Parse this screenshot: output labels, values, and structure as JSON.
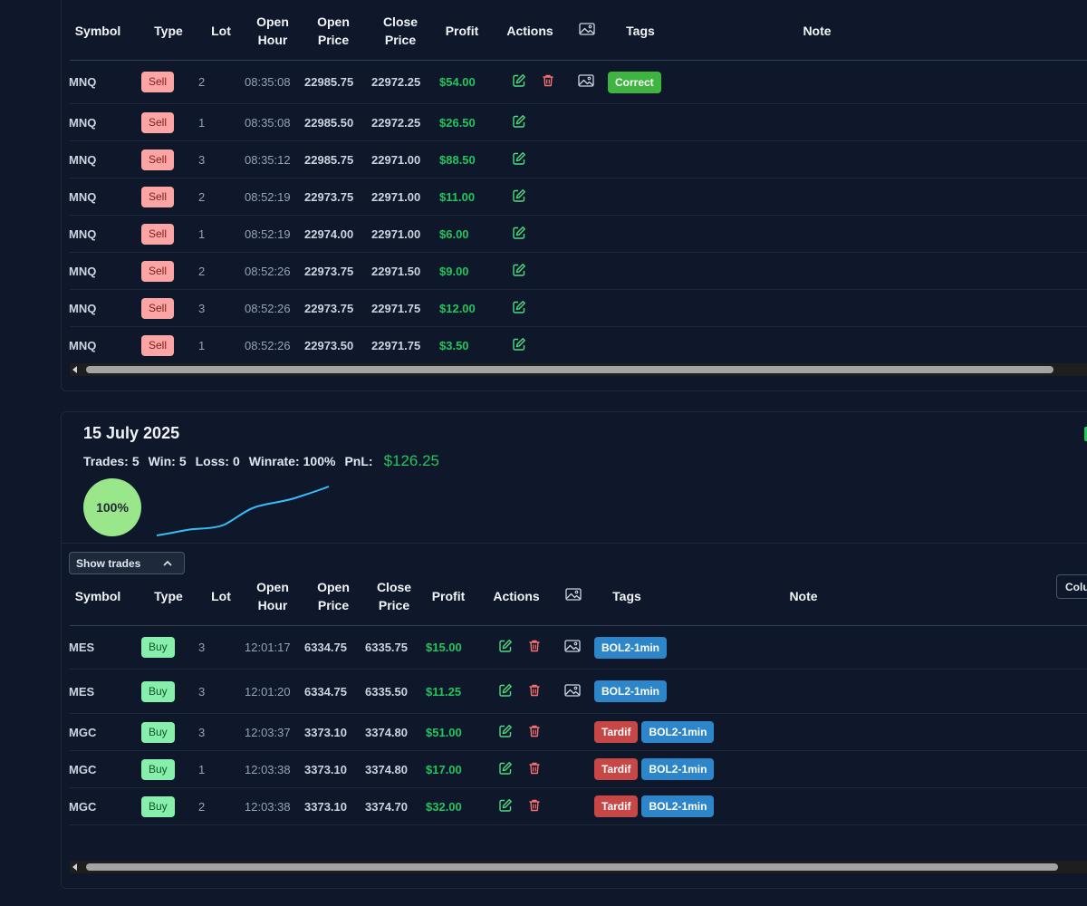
{
  "colors": {
    "background": "#0f172a",
    "profit": "#22c55e",
    "sell_badge": "#fca5a5",
    "buy_badge": "#86efac",
    "tag_correct": "#3fb541",
    "tag_bol2": "#2d86c9",
    "tag_tardif": "#c74747",
    "winrate_circle": "#9ae68a",
    "sparkline": "#38bdf8"
  },
  "table1": {
    "headers": {
      "symbol": "Symbol",
      "type": "Type",
      "lot": "Lot",
      "open_hour_1": "Open",
      "open_hour_2": "Hour",
      "open_price_1": "Open",
      "open_price_2": "Price",
      "close_price_1": "Close",
      "close_price_2": "Price",
      "profit": "Profit",
      "actions": "Actions",
      "image_icon": "image-icon",
      "tags": "Tags",
      "note": "Note"
    },
    "rows": [
      {
        "symbol": "MNQ",
        "type": "Sell",
        "lot": "2",
        "open_hour": "08:35:08",
        "open_price": "22985.75",
        "close_price": "22972.25",
        "profit": "$54.00",
        "tags": [
          "Correct"
        ]
      },
      {
        "symbol": "MNQ",
        "type": "Sell",
        "lot": "1",
        "open_hour": "08:35:08",
        "open_price": "22985.50",
        "close_price": "22972.25",
        "profit": "$26.50",
        "tags": []
      },
      {
        "symbol": "MNQ",
        "type": "Sell",
        "lot": "3",
        "open_hour": "08:35:12",
        "open_price": "22985.75",
        "close_price": "22971.00",
        "profit": "$88.50",
        "tags": []
      },
      {
        "symbol": "MNQ",
        "type": "Sell",
        "lot": "2",
        "open_hour": "08:52:19",
        "open_price": "22973.75",
        "close_price": "22971.00",
        "profit": "$11.00",
        "tags": []
      },
      {
        "symbol": "MNQ",
        "type": "Sell",
        "lot": "1",
        "open_hour": "08:52:19",
        "open_price": "22974.00",
        "close_price": "22971.00",
        "profit": "$6.00",
        "tags": []
      },
      {
        "symbol": "MNQ",
        "type": "Sell",
        "lot": "2",
        "open_hour": "08:52:26",
        "open_price": "22973.75",
        "close_price": "22971.50",
        "profit": "$9.00",
        "tags": []
      },
      {
        "symbol": "MNQ",
        "type": "Sell",
        "lot": "3",
        "open_hour": "08:52:26",
        "open_price": "22973.75",
        "close_price": "22971.75",
        "profit": "$12.00",
        "tags": []
      },
      {
        "symbol": "MNQ",
        "type": "Sell",
        "lot": "1",
        "open_hour": "08:52:26",
        "open_price": "22973.50",
        "close_price": "22971.75",
        "profit": "$3.50",
        "tags": []
      }
    ]
  },
  "day": {
    "title": "15 July 2025",
    "stats": {
      "trades_label": "Trades:",
      "trades": "5",
      "win_label": "Win:",
      "win": "5",
      "loss_label": "Loss:",
      "loss": "0",
      "winrate_label": "Winrate:",
      "winrate": "100%",
      "pnl_label": "PnL:",
      "pnl": "$126.25"
    },
    "winrate_circle": "100%",
    "show_trades_label": "Show trades",
    "columns_label": "Columns"
  },
  "table2": {
    "headers": {
      "symbol": "Symbol",
      "type": "Type",
      "lot": "Lot",
      "open_hour_1": "Open",
      "open_hour_2": "Hour",
      "open_price_1": "Open",
      "open_price_2": "Price",
      "close_price_1": "Close",
      "close_price_2": "Price",
      "profit": "Profit",
      "actions": "Actions",
      "image_icon": "image-icon",
      "tags": "Tags",
      "note": "Note"
    },
    "rows": [
      {
        "symbol": "MES",
        "type": "Buy",
        "lot": "3",
        "open_hour": "12:01:17",
        "open_price": "6334.75",
        "close_price": "6335.75",
        "profit": "$15.00",
        "tags": [
          "BOL2-1min"
        ]
      },
      {
        "symbol": "MES",
        "type": "Buy",
        "lot": "3",
        "open_hour": "12:01:20",
        "open_price": "6334.75",
        "close_price": "6335.50",
        "profit": "$11.25",
        "tags": [
          "BOL2-1min"
        ]
      },
      {
        "symbol": "MGC",
        "type": "Buy",
        "lot": "3",
        "open_hour": "12:03:37",
        "open_price": "3373.10",
        "close_price": "3374.80",
        "profit": "$51.00",
        "tags": [
          "Tardif",
          "BOL2-1min"
        ]
      },
      {
        "symbol": "MGC",
        "type": "Buy",
        "lot": "1",
        "open_hour": "12:03:38",
        "open_price": "3373.10",
        "close_price": "3374.80",
        "profit": "$17.00",
        "tags": [
          "Tardif",
          "BOL2-1min"
        ]
      },
      {
        "symbol": "MGC",
        "type": "Buy",
        "lot": "2",
        "open_hour": "12:03:38",
        "open_price": "3373.10",
        "close_price": "3374.70",
        "profit": "$32.00",
        "tags": [
          "Tardif",
          "BOL2-1min"
        ]
      }
    ]
  }
}
